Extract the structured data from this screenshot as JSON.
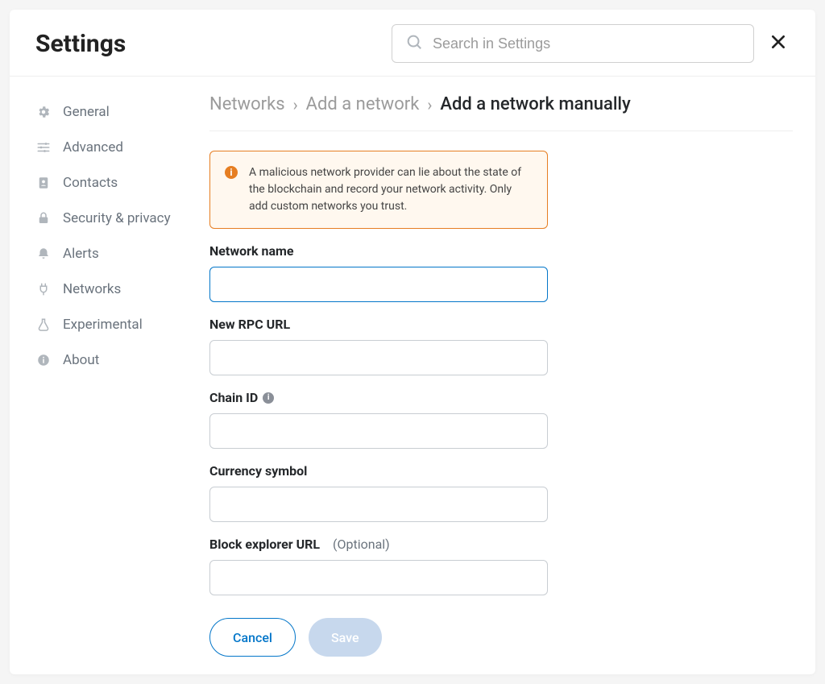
{
  "header": {
    "title": "Settings",
    "search_placeholder": "Search in Settings"
  },
  "sidebar": {
    "items": [
      {
        "label": "General"
      },
      {
        "label": "Advanced"
      },
      {
        "label": "Contacts"
      },
      {
        "label": "Security & privacy"
      },
      {
        "label": "Alerts"
      },
      {
        "label": "Networks"
      },
      {
        "label": "Experimental"
      },
      {
        "label": "About"
      }
    ]
  },
  "breadcrumb": {
    "networks": "Networks",
    "add_network": "Add a network",
    "current": "Add a network manually"
  },
  "warning": {
    "text": "A malicious network provider can lie about the state of the blockchain and record your network activity. Only add custom networks you trust."
  },
  "form": {
    "network_name_label": "Network name",
    "rpc_url_label": "New RPC URL",
    "chain_id_label": "Chain ID",
    "currency_symbol_label": "Currency symbol",
    "block_explorer_label": "Block explorer URL",
    "optional": "(Optional)",
    "network_name_value": "",
    "rpc_url_value": "",
    "chain_id_value": "",
    "currency_symbol_value": "",
    "block_explorer_value": ""
  },
  "actions": {
    "cancel": "Cancel",
    "save": "Save"
  }
}
